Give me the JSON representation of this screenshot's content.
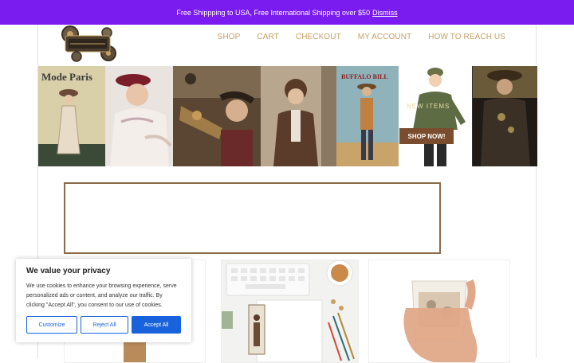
{
  "notice": {
    "text": "Free Shippping to USA, Free International Shipping over $50",
    "dismiss": "Dismiss"
  },
  "nav": {
    "items": [
      "SHOP",
      "CART",
      "CHECKOUT",
      "MY ACCOUNT",
      "HOW TO REACH US"
    ]
  },
  "banner": {
    "poster_text": "Mode Paris",
    "buffalo_text": "BUFFALO BILL",
    "new_text": "NEW ITEMS",
    "shop_now": "SHOP NOW!"
  },
  "cookie": {
    "title": "We value your privacy",
    "description": "We use cookies to enhance your browsing experience, serve personalized ads or content, and analyze our traffic. By clicking \"Accept All\", you consent to our use of cookies.",
    "customize": "Customize",
    "reject": "Reject All",
    "accept": "Accept All"
  },
  "colors": {
    "notice_bg": "#7a1cf0",
    "nav_text": "#c7a064",
    "shop_button": "#7a4d2e",
    "cookie_accent": "#1863dc"
  }
}
